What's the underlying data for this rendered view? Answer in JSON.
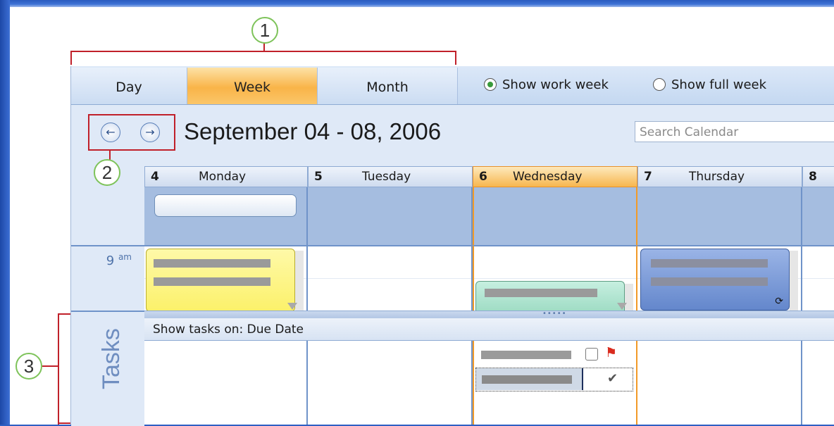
{
  "callouts": [
    "1",
    "2",
    "3"
  ],
  "view_tabs": [
    {
      "label": "Day",
      "active": false
    },
    {
      "label": "Week",
      "active": true
    },
    {
      "label": "Month",
      "active": false
    }
  ],
  "week_options": {
    "work_week_label": "Show work week",
    "work_week_selected": true,
    "full_week_label": "Show full week",
    "full_week_selected": false
  },
  "navigation": {
    "back_icon": "arrow-left-circle-icon",
    "forward_icon": "arrow-right-circle-icon"
  },
  "date_range": "September 04 - 08, 2006",
  "search": {
    "placeholder": "Search Calendar"
  },
  "days": [
    {
      "num": "4",
      "name": "Monday",
      "today": false
    },
    {
      "num": "5",
      "name": "Tuesday",
      "today": false
    },
    {
      "num": "6",
      "name": "Wednesday",
      "today": true
    },
    {
      "num": "7",
      "name": "Thursday",
      "today": false
    },
    {
      "num": "8",
      "name": "",
      "today": false
    }
  ],
  "time_slot": {
    "hour": "9",
    "suffix": "am"
  },
  "tasks": {
    "panel_label": "Tasks",
    "show_on_label": "Show tasks on: Due Date",
    "items": [
      {
        "day": "Wednesday",
        "completed": false,
        "flagged": true
      },
      {
        "day": "Wednesday",
        "completed": true,
        "flagged": false
      }
    ]
  },
  "colors": {
    "accent_today": "#f29a27",
    "callout_ring": "#7ec35a",
    "callout_bracket": "#c0202a",
    "appointment_yellow": "#fdf37a",
    "appointment_green": "#a9e0c9",
    "appointment_blue": "#6e8fd0"
  }
}
